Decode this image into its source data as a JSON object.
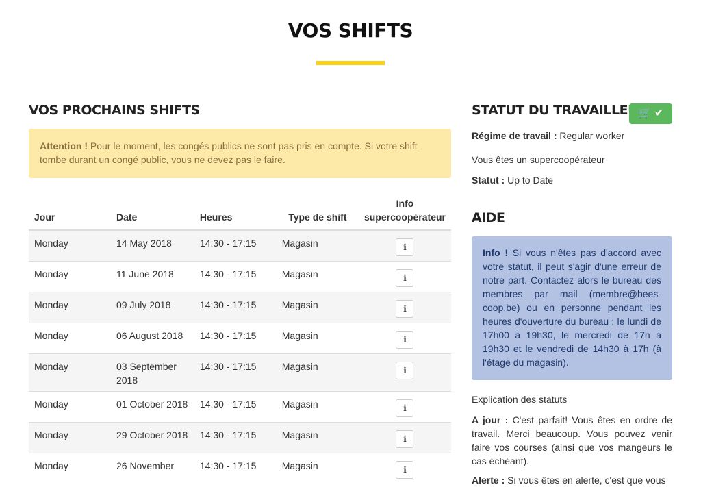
{
  "page": {
    "title": "VOS SHIFTS",
    "accent_color": "#f8d11c"
  },
  "left": {
    "heading": "VOS PROCHAINS SHIFTS",
    "alert": {
      "bold": "Attention !",
      "text": " Pour le moment, les congés publics ne sont pas pris en compte. Si votre shift tombe durant un congé public, vous ne devez pas le faire.",
      "bg": "#fdeaa8",
      "color": "#8a6d3b"
    },
    "table": {
      "headers": [
        "Jour",
        "Date",
        "Heures",
        "Type de shift",
        "Info supercoopérateur"
      ],
      "rows": [
        [
          "Monday",
          "14 May 2018",
          "14:30 - 17:15",
          "Magasin"
        ],
        [
          "Monday",
          "11 June 2018",
          "14:30 - 17:15",
          "Magasin"
        ],
        [
          "Monday",
          "09 July 2018",
          "14:30 - 17:15",
          "Magasin"
        ],
        [
          "Monday",
          "06 August 2018",
          "14:30 - 17:15",
          "Magasin"
        ],
        [
          "Monday",
          "03 September 2018",
          "14:30 - 17:15",
          "Magasin"
        ],
        [
          "Monday",
          "01 October 2018",
          "14:30 - 17:15",
          "Magasin"
        ],
        [
          "Monday",
          "29 October 2018",
          "14:30 - 17:15",
          "Magasin"
        ],
        [
          "Monday",
          "26 November",
          "14:30 - 17:15",
          "Magasin"
        ]
      ],
      "info_icon": "i"
    }
  },
  "right": {
    "heading": "STATUT DU TRAVAILLEUR",
    "badge": {
      "icons": "cart-icon check-icon",
      "cart": "🛒",
      "check": "✔",
      "bg": "#5cb85c"
    },
    "regime_label": "Régime de travail :",
    "regime_value": " Regular worker",
    "super_text": "Vous êtes un supercoopérateur",
    "statut_label": "Statut :",
    "statut_value": " Up to Date",
    "aide_heading": "AIDE",
    "info_alert": {
      "bold": "Info !",
      "text": " Si vous n'êtes pas d'accord avec votre statut, il peut s'agir d'une erreur de notre part. Contactez alors le bureau des membres par mail (membre@bees-coop.be) ou en personne pendant les heures d'ouverture du bureau : le lundi de 17h00 à 19h30, le mercredi de 17h à 19h30 et le vendredi de 14h30 à 17h (à l'étage du magasin).",
      "bg": "#b3c2e3",
      "color": "#1f3a6e"
    },
    "explication": "Explication des statuts",
    "ajour_label": "A jour :",
    "ajour_text": " C'est parfait! Vous êtes en ordre de travail. Merci beaucoup. Vous pouvez venir faire vos courses (ainsi que vos mangeurs le cas échéant).",
    "alerte_label": "Alerte :",
    "alerte_text": " Si vous êtes en alerte, c'est que vous"
  }
}
